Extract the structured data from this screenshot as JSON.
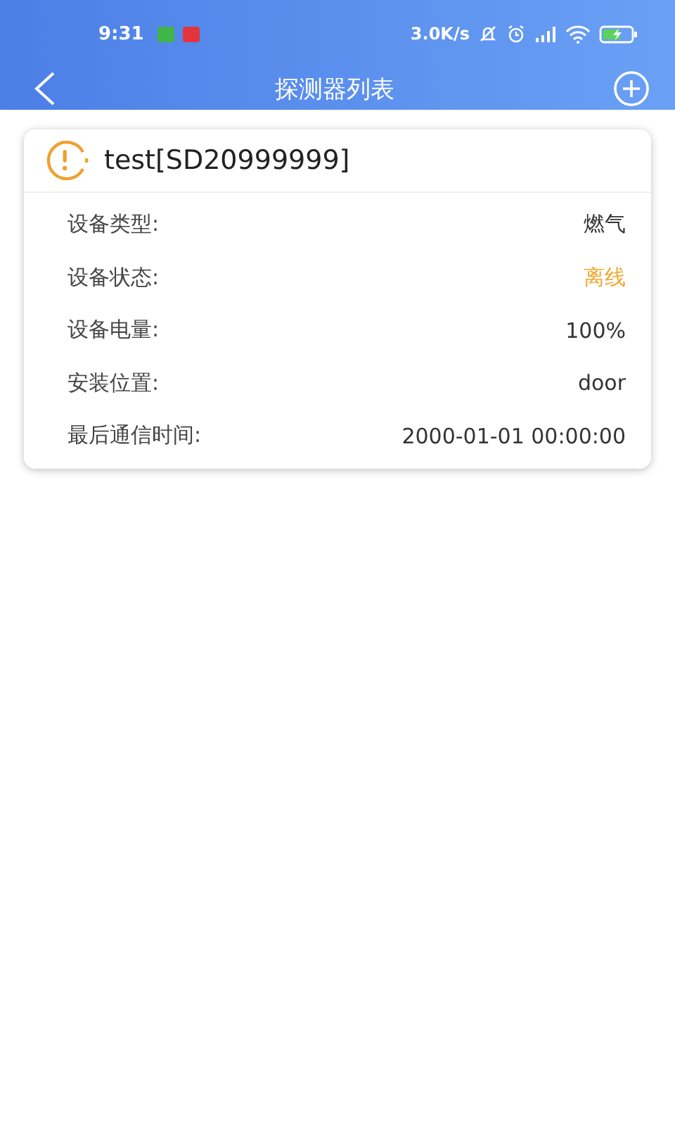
{
  "status_bar": {
    "time": "9:31",
    "speed": "3.0K/s"
  },
  "header": {
    "title": "探测器列表"
  },
  "devices": [
    {
      "name": "test[SD20999999]",
      "fields": [
        {
          "label": "设备类型:",
          "value": "燃气",
          "color": "#333333"
        },
        {
          "label": "设备状态:",
          "value": "离线",
          "color": "#f0a833"
        },
        {
          "label": "设备电量:",
          "value": "100%",
          "color": "#333333"
        },
        {
          "label": "安装位置:",
          "value": "door",
          "color": "#333333"
        },
        {
          "label": "最后通信时间:",
          "value": "2000-01-01 00:00:00",
          "color": "#333333"
        }
      ]
    }
  ]
}
